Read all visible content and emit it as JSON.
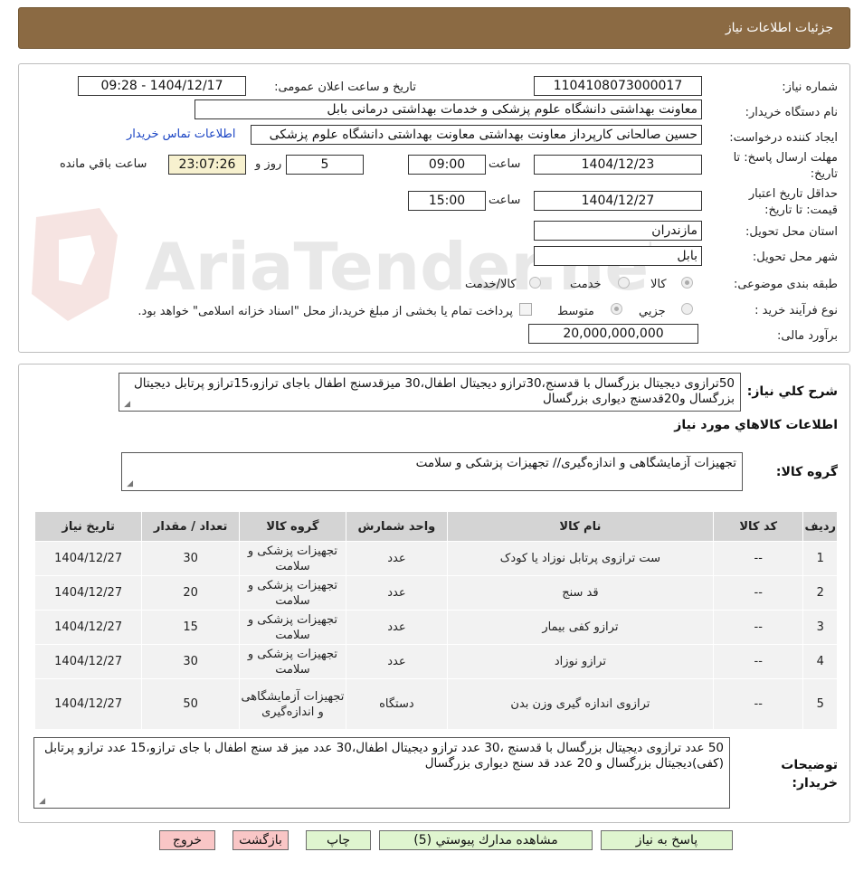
{
  "header": {
    "title": "جزئیات اطلاعات نیاز"
  },
  "labels": {
    "need_number": "شماره نیاز:",
    "announce_datetime": "تاریخ و ساعت اعلان عمومی:",
    "buyer_org": "نام دستگاه خریدار:",
    "requester": "ایجاد کننده درخواست:",
    "deadline": "مهلت ارسال پاسخ: تا تاریخ:",
    "validity": "حداقل تاریخ اعتبار قیمت: تا تاریخ:",
    "province": "استان محل تحویل:",
    "city": "شهر محل تحویل:",
    "category": "طبقه بندی موضوعی:",
    "process": "نوع فرآیند خرید :",
    "estimate": "برآورد مالی:",
    "time_word": "ساعت",
    "time_word2": "ساعت",
    "day_and": "روز و",
    "remaining": "ساعت باقي مانده"
  },
  "values": {
    "need_number": "1104108073000017",
    "announce_datetime": "1404/12/17 - 09:28",
    "buyer_org": "معاونت بهداشتی دانشگاه علوم پزشکی و خدمات بهداشتی درمانی بابل",
    "requester": "حسین صالحانی کارپرداز معاونت بهداشتی معاونت بهداشتی دانشگاه علوم پزشکی",
    "contact_link": "اطلاعات تماس خریدار",
    "deadline_date": "1404/12/23",
    "deadline_time": "09:00",
    "days_left": "5",
    "time_left": "23:07:26",
    "validity_date": "1404/12/27",
    "validity_time": "15:00",
    "province": "مازندران",
    "city": "بابل",
    "estimate": "20,000,000,000"
  },
  "category_options": [
    "کالا",
    "خدمت",
    "کالا/خدمت"
  ],
  "process_options": [
    "جزیي",
    "متوسط"
  ],
  "process_note": "پرداخت تمام یا بخشی از مبلغ خرید،از محل \"اسناد خزانه اسلامی\" خواهد بود.",
  "summary": {
    "label": "شرح كلي نياز:",
    "text": "50ترازوی دیجیتال بزرگسال با قدسنج،30ترازو دیجیتال اطفال،30 میزقدسنج اطفال باجای ترازو،15ترازو پرتابل دیجیتال بزرگسال و20قدسنج دیواری بزرگسال"
  },
  "goods_section_title": "اطلاعات كالاهاي مورد نياز",
  "goods_group": {
    "label": "گروه کالا:",
    "text": "تجهیزات آزمایشگاهی و اندازه‌گیری// تجهیزات پزشکی و سلامت"
  },
  "table": {
    "headers": [
      "ردیف",
      "کد کالا",
      "نام کالا",
      "واحد شمارش",
      "گروه کالا",
      "تعداد / مقدار",
      "تاریخ نیاز"
    ],
    "rows": [
      [
        "1",
        "--",
        "ست ترازوی پرتابل نوزاد یا کودک",
        "عدد",
        "تجهیزات پزشکی و سلامت",
        "30",
        "1404/12/27"
      ],
      [
        "2",
        "--",
        "قد سنج",
        "عدد",
        "تجهیزات پزشکی و سلامت",
        "20",
        "1404/12/27"
      ],
      [
        "3",
        "--",
        "ترازو کفی بیمار",
        "عدد",
        "تجهیزات پزشکی و سلامت",
        "15",
        "1404/12/27"
      ],
      [
        "4",
        "--",
        "ترازو نوزاد",
        "عدد",
        "تجهیزات پزشکی و سلامت",
        "30",
        "1404/12/27"
      ],
      [
        "5",
        "--",
        "ترازوی اندازه گیری وزن بدن",
        "دستگاه",
        "تجهیزات آزمایشگاهی و اندازه‌گیری",
        "50",
        "1404/12/27"
      ]
    ]
  },
  "buyer_notes": {
    "label": "توضیحات خریدار:",
    "text": "50 عدد ترازوی دیجیتال  بزرگسال با قدسنج ،30 عدد ترازو دیجیتال اطفال،30 عدد میز قد سنج اطفال با جای ترازو،15 عدد ترازو پرتابل (کفی)دیجیتال بزرگسال و 20 عدد قد سنج دیواری بزرگسال"
  },
  "buttons": {
    "reply": "پاسخ به نیاز",
    "attachments": "مشاهده مدارك پيوستي (5)",
    "print": "چاپ",
    "back": "بازگشت",
    "exit": "خروج"
  },
  "watermark": "AriaTender.neT",
  "colors": {
    "header_bg": "#8b6a43",
    "green_btn": "#dff5cf",
    "pink_btn": "#f9c6c6",
    "yellow_box": "#f7f1cf"
  }
}
